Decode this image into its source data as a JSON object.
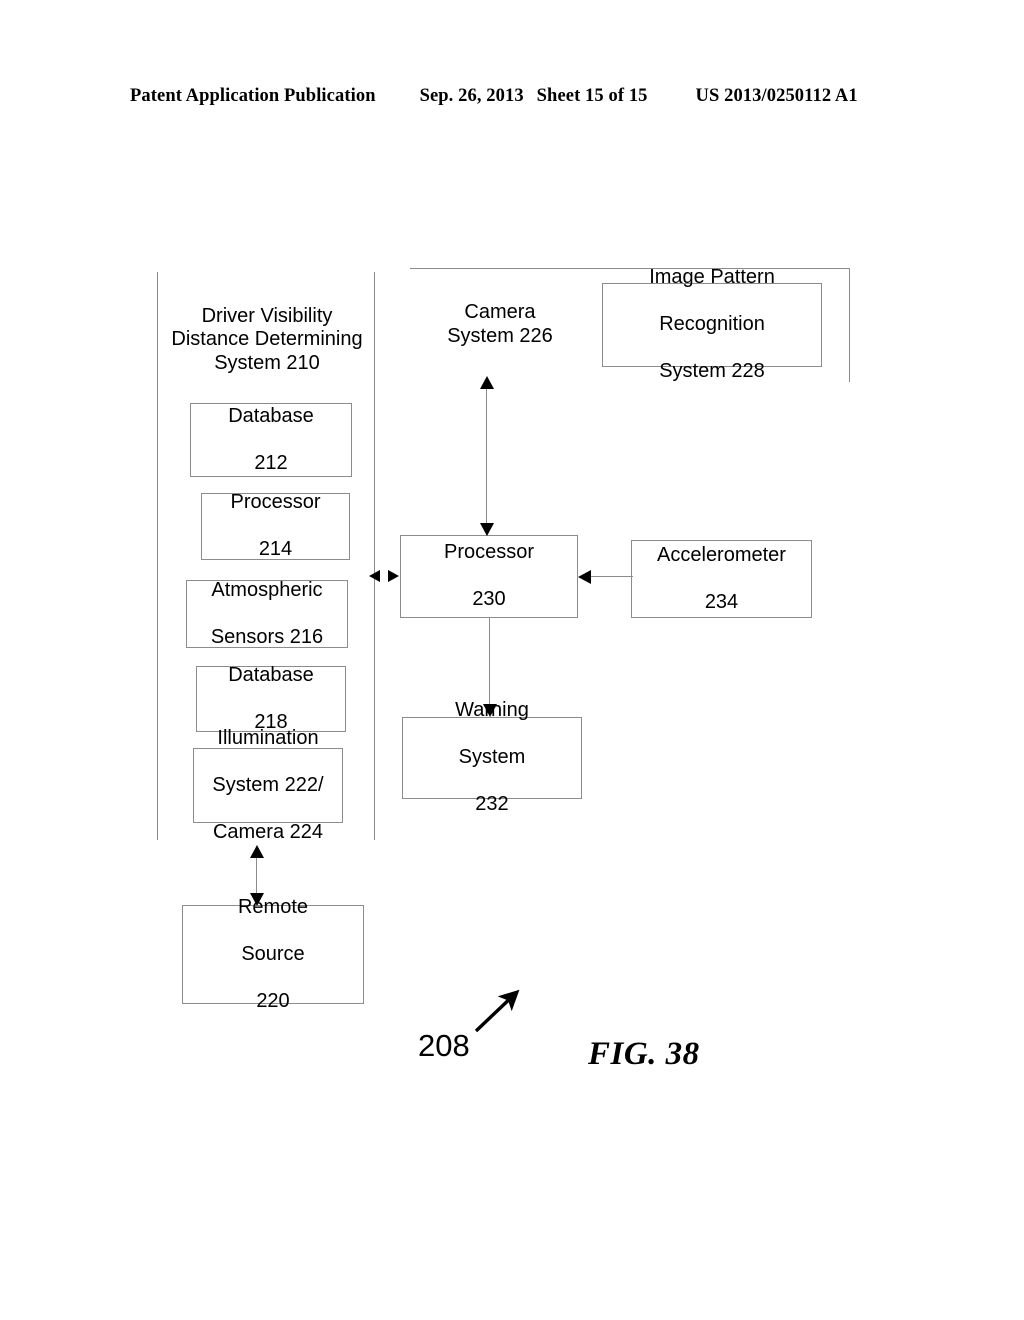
{
  "header": {
    "publication": "Patent Application Publication",
    "date": "Sep. 26, 2013",
    "sheet": "Sheet 15 of 15",
    "patent_number": "US 2013/0250112 A1"
  },
  "figure": {
    "caption": "FIG. 38",
    "reference_numeral": "208"
  },
  "diagram": {
    "left_group": {
      "title_lines": [
        "Driver Visibility",
        "Distance Determining",
        "System 210"
      ],
      "title_text": "Driver Visibility Distance Determining System 210",
      "boxes": [
        {
          "id": "database-212",
          "lines": [
            "Database",
            "212"
          ],
          "text": "Database 212"
        },
        {
          "id": "processor-214",
          "lines": [
            "Processor",
            "214"
          ],
          "text": "Processor 214"
        },
        {
          "id": "atmospheric-sensors-216",
          "lines": [
            "Atmospheric",
            "Sensors 216"
          ],
          "text": "Atmospheric Sensors 216"
        },
        {
          "id": "database-218",
          "lines": [
            "Database",
            "218"
          ],
          "text": "Database 218"
        },
        {
          "id": "illumination-system-222",
          "lines": [
            "Illumination",
            "System 222/",
            "Camera 224"
          ],
          "text": "Illumination System 222/ Camera 224"
        }
      ]
    },
    "right_group": {
      "title_lines": [
        "Camera",
        "System 226"
      ],
      "title_text": "Camera System 226",
      "boxes": [
        {
          "id": "image-pattern-recognition-228",
          "lines": [
            "Image Pattern",
            "Recognition",
            "System 228"
          ],
          "text": "Image Pattern Recognition System 228"
        }
      ]
    },
    "standalone_boxes": [
      {
        "id": "processor-230",
        "lines": [
          "Processor",
          "230"
        ],
        "text": "Processor 230"
      },
      {
        "id": "accelerometer-234",
        "lines": [
          "Accelerometer",
          "234"
        ],
        "text": "Accelerometer 234"
      },
      {
        "id": "warning-system-232",
        "lines": [
          "Warning",
          "System",
          "232"
        ],
        "text": "Warning System 232"
      },
      {
        "id": "remote-source-220",
        "lines": [
          "Remote",
          "Source",
          "220"
        ],
        "text": "Remote Source 220"
      }
    ],
    "connections": [
      {
        "from": "Camera System 226",
        "to": "Processor 230",
        "direction": "bidirectional"
      },
      {
        "from": "Driver Visibility Distance Determining System 210",
        "to": "Processor 230",
        "direction": "bidirectional"
      },
      {
        "from": "Accelerometer 234",
        "to": "Processor 230",
        "direction": "unidirectional"
      },
      {
        "from": "Processor 230",
        "to": "Warning System 232",
        "direction": "unidirectional"
      },
      {
        "from": "Illumination System 222/ Camera 224",
        "to": "Remote Source 220",
        "direction": "bidirectional"
      }
    ]
  },
  "colors": {
    "ink": "#000000",
    "line": "#8c8c8c",
    "background": "#ffffff"
  }
}
